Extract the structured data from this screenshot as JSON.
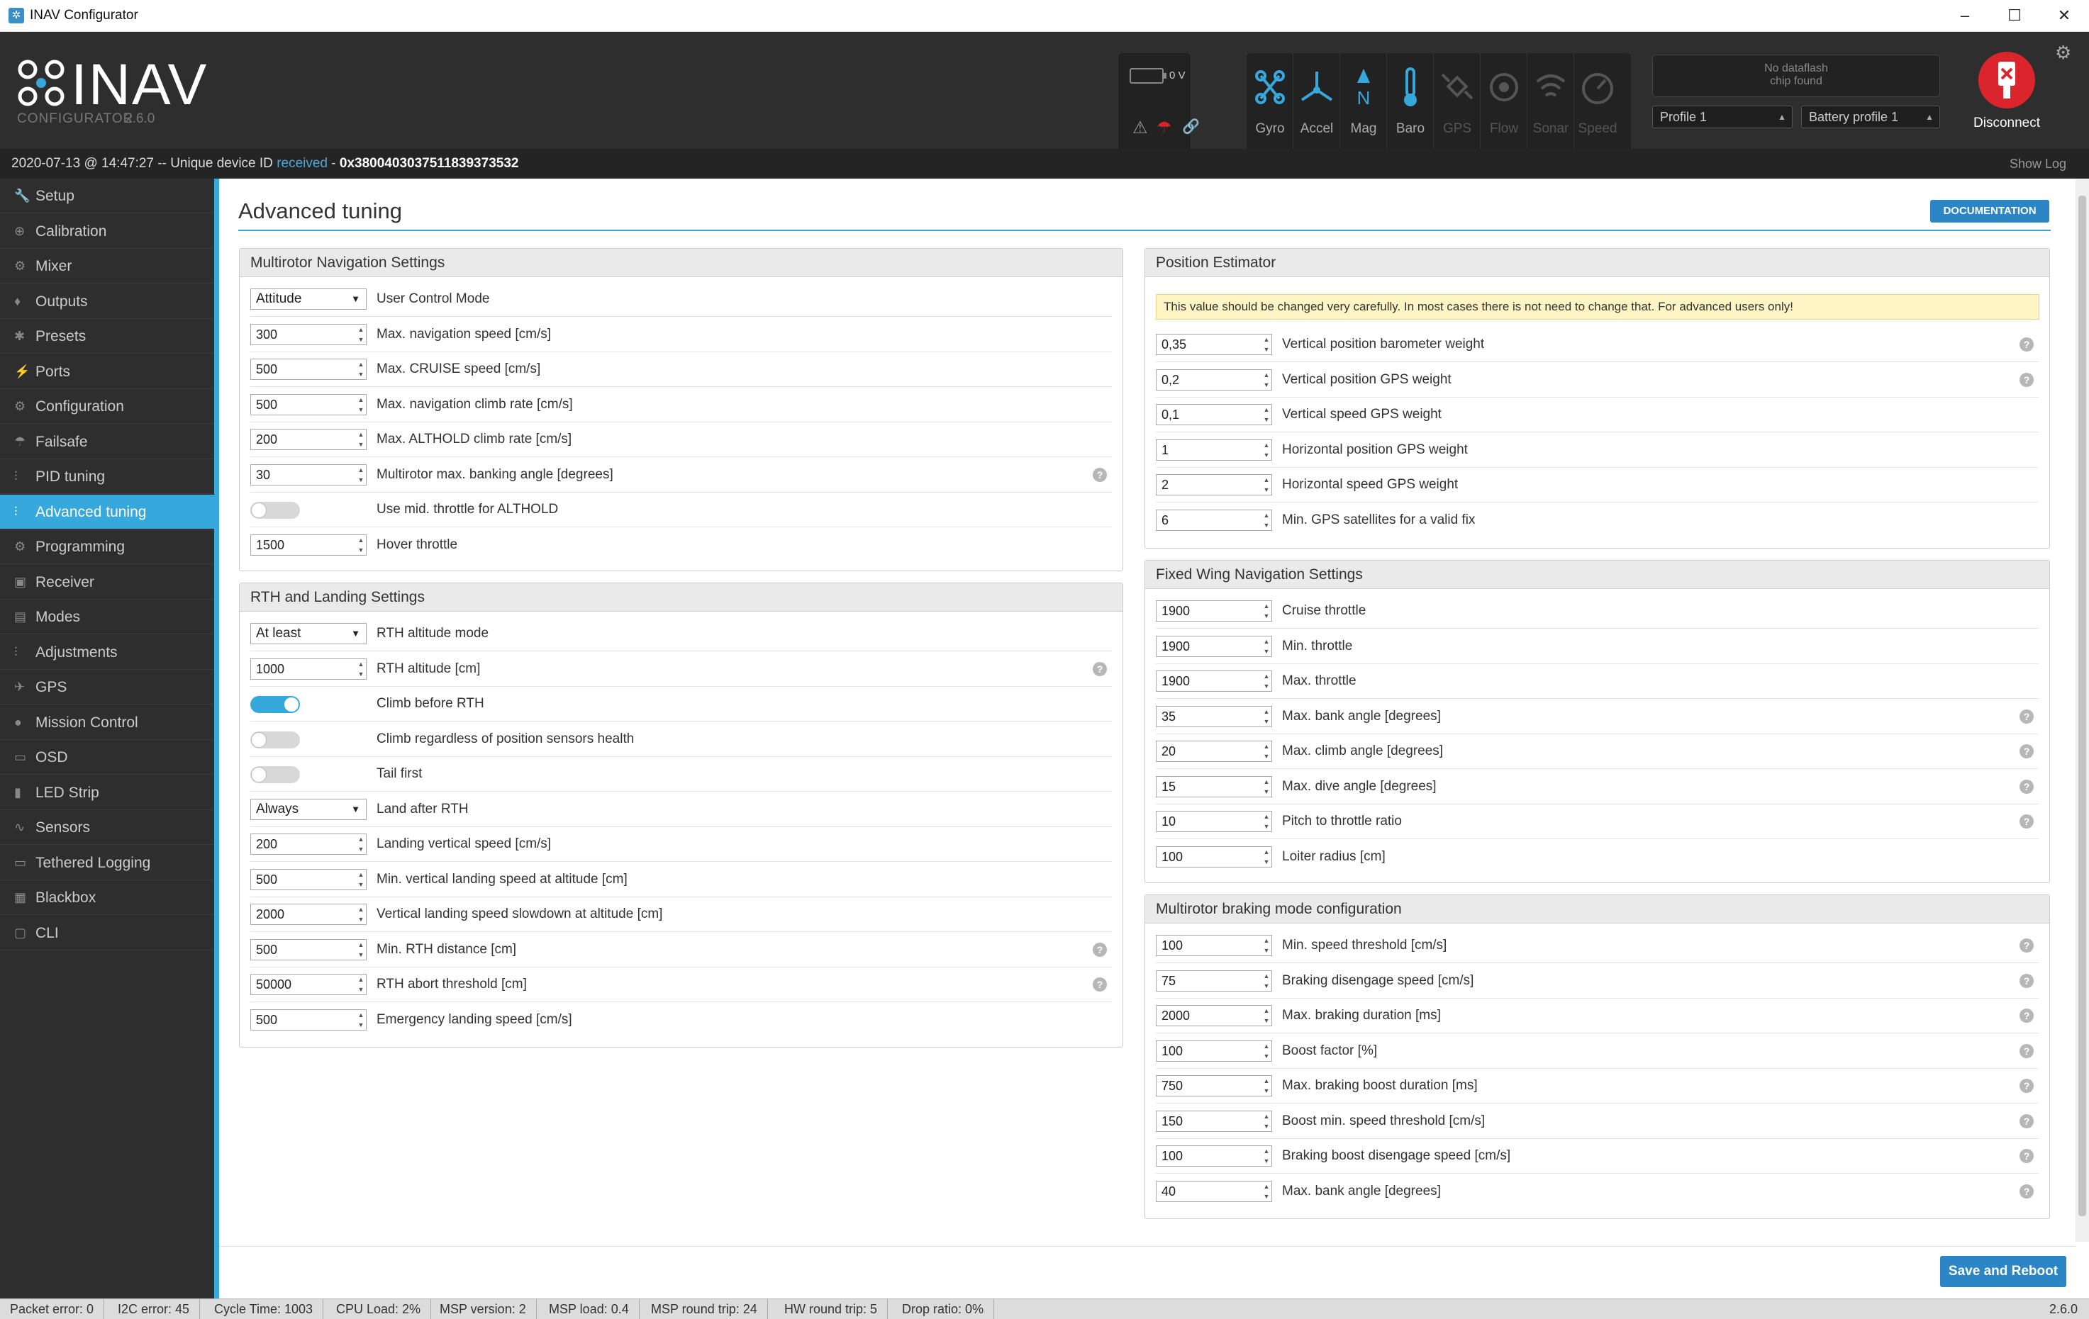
{
  "window": {
    "title": "INAV Configurator",
    "minimize": "–",
    "maximize": "☐",
    "close": "✕"
  },
  "header": {
    "logo_text": "INAV",
    "logo_sub": "CONFIGURATOR",
    "version": "2.6.0",
    "battery_voltage": "0 V",
    "sensors": [
      {
        "label": "Gyro",
        "active": true
      },
      {
        "label": "Accel",
        "active": true
      },
      {
        "label": "Mag",
        "active": true
      },
      {
        "label": "Baro",
        "active": true
      },
      {
        "label": "GPS",
        "active": false
      },
      {
        "label": "Flow",
        "active": false
      },
      {
        "label": "Sonar",
        "active": false
      },
      {
        "label": "Speed",
        "active": false
      }
    ],
    "dataflash_line1": "No dataflash",
    "dataflash_line2": "chip found",
    "profile": "Profile 1",
    "battery_profile": "Battery profile 1",
    "disconnect_label": "Disconnect"
  },
  "log": {
    "prefix": "2020-07-13 @ 14:47:27 -- Unique device ID ",
    "received": "received",
    "sep": " - ",
    "device_id": "0x380040303751183937353​2",
    "show_log": "Show Log"
  },
  "sidebar": {
    "items": [
      {
        "label": "Setup",
        "icon": "wrench-icon",
        "glyph": "🔧"
      },
      {
        "label": "Calibration",
        "icon": "crosshair-icon",
        "glyph": "⊕"
      },
      {
        "label": "Mixer",
        "icon": "mixer-icon",
        "glyph": "⚙"
      },
      {
        "label": "Outputs",
        "icon": "outputs-icon",
        "glyph": "♦"
      },
      {
        "label": "Presets",
        "icon": "presets-icon",
        "glyph": "✱"
      },
      {
        "label": "Ports",
        "icon": "plug-icon",
        "glyph": "⚡"
      },
      {
        "label": "Configuration",
        "icon": "gear-icon",
        "glyph": "⚙"
      },
      {
        "label": "Failsafe",
        "icon": "parachute-icon",
        "glyph": "☂"
      },
      {
        "label": "PID tuning",
        "icon": "sliders-icon",
        "glyph": "⫶"
      },
      {
        "label": "Advanced tuning",
        "icon": "tuning-icon",
        "glyph": "⫶"
      },
      {
        "label": "Programming",
        "icon": "cog-icon",
        "glyph": "⚙"
      },
      {
        "label": "Receiver",
        "icon": "receiver-icon",
        "glyph": "▣"
      },
      {
        "label": "Modes",
        "icon": "modes-icon",
        "glyph": "▤"
      },
      {
        "label": "Adjustments",
        "icon": "adjust-icon",
        "glyph": "⫶"
      },
      {
        "label": "GPS",
        "icon": "satellite-icon",
        "glyph": "✈"
      },
      {
        "label": "Mission Control",
        "icon": "map-pin-icon",
        "glyph": "●"
      },
      {
        "label": "OSD",
        "icon": "osd-icon",
        "glyph": "▭"
      },
      {
        "label": "LED Strip",
        "icon": "led-icon",
        "glyph": "▮"
      },
      {
        "label": "Sensors",
        "icon": "pulse-icon",
        "glyph": "∿"
      },
      {
        "label": "Tethered Logging",
        "icon": "tether-icon",
        "glyph": "▭"
      },
      {
        "label": "Blackbox",
        "icon": "blackbox-icon",
        "glyph": "▦"
      },
      {
        "label": "CLI",
        "icon": "terminal-icon",
        "glyph": "▢"
      }
    ],
    "active_index": 9
  },
  "page": {
    "title": "Advanced tuning",
    "documentation": "DOCUMENTATION",
    "save_reboot": "Save and Reboot"
  },
  "mc_nav": {
    "title": "Multirotor Navigation Settings",
    "rows": [
      {
        "type": "select",
        "value": "Attitude",
        "label": "User Control Mode"
      },
      {
        "type": "num",
        "value": "300",
        "label": "Max. navigation speed [cm/s]"
      },
      {
        "type": "num",
        "value": "500",
        "label": "Max. CRUISE speed [cm/s]"
      },
      {
        "type": "num",
        "value": "500",
        "label": "Max. navigation climb rate [cm/s]"
      },
      {
        "type": "num",
        "value": "200",
        "label": "Max. ALTHOLD climb rate [cm/s]"
      },
      {
        "type": "num",
        "value": "30",
        "label": "Multirotor max. banking angle [degrees]",
        "help": true
      },
      {
        "type": "toggle",
        "on": false,
        "label": "Use mid. throttle for ALTHOLD"
      },
      {
        "type": "num",
        "value": "1500",
        "label": "Hover throttle"
      }
    ]
  },
  "rth": {
    "title": "RTH and Landing Settings",
    "rows": [
      {
        "type": "select",
        "value": "At least",
        "label": "RTH altitude mode"
      },
      {
        "type": "num",
        "value": "1000",
        "label": "RTH altitude [cm]",
        "help": true
      },
      {
        "type": "toggle",
        "on": true,
        "label": "Climb before RTH"
      },
      {
        "type": "toggle",
        "on": false,
        "label": "Climb regardless of position sensors health"
      },
      {
        "type": "toggle",
        "on": false,
        "label": "Tail first"
      },
      {
        "type": "select",
        "value": "Always",
        "label": "Land after RTH"
      },
      {
        "type": "num",
        "value": "200",
        "label": "Landing vertical speed [cm/s]"
      },
      {
        "type": "num",
        "value": "500",
        "label": "Min. vertical landing speed at altitude [cm]"
      },
      {
        "type": "num",
        "value": "2000",
        "label": "Vertical landing speed slowdown at altitude [cm]"
      },
      {
        "type": "num",
        "value": "500",
        "label": "Min. RTH distance [cm]",
        "help": true
      },
      {
        "type": "num",
        "value": "50000",
        "label": "RTH abort threshold [cm]",
        "help": true
      },
      {
        "type": "num",
        "value": "500",
        "label": "Emergency landing speed [cm/s]"
      }
    ]
  },
  "pos_est": {
    "title": "Position Estimator",
    "warning": "This value should be changed very carefully. In most cases there is not need to change that. For advanced users only!",
    "rows": [
      {
        "type": "num",
        "value": "0,35",
        "label": "Vertical position barometer weight",
        "help": true
      },
      {
        "type": "num",
        "value": "0,2",
        "label": "Vertical position GPS weight",
        "help": true
      },
      {
        "type": "num",
        "value": "0,1",
        "label": "Vertical speed GPS weight"
      },
      {
        "type": "num",
        "value": "1",
        "label": "Horizontal position GPS weight"
      },
      {
        "type": "num",
        "value": "2",
        "label": "Horizontal speed GPS weight"
      },
      {
        "type": "num",
        "value": "6",
        "label": "Min. GPS satellites for a valid fix"
      }
    ]
  },
  "fw_nav": {
    "title": "Fixed Wing Navigation Settings",
    "rows": [
      {
        "type": "num",
        "value": "1900",
        "label": "Cruise throttle"
      },
      {
        "type": "num",
        "value": "1900",
        "label": "Min. throttle"
      },
      {
        "type": "num",
        "value": "1900",
        "label": "Max. throttle"
      },
      {
        "type": "num",
        "value": "35",
        "label": "Max. bank angle [degrees]",
        "help": true
      },
      {
        "type": "num",
        "value": "20",
        "label": "Max. climb angle [degrees]",
        "help": true
      },
      {
        "type": "num",
        "value": "15",
        "label": "Max. dive angle [degrees]",
        "help": true
      },
      {
        "type": "num",
        "value": "10",
        "label": "Pitch to throttle ratio",
        "help": true
      },
      {
        "type": "num",
        "value": "100",
        "label": "Loiter radius [cm]"
      }
    ]
  },
  "braking": {
    "title": "Multirotor braking mode configuration",
    "rows": [
      {
        "type": "num",
        "value": "100",
        "label": "Min. speed threshold [cm/s]",
        "help": true
      },
      {
        "type": "num",
        "value": "75",
        "label": "Braking disengage speed [cm/s]",
        "help": true
      },
      {
        "type": "num",
        "value": "2000",
        "label": "Max. braking duration [ms]",
        "help": true
      },
      {
        "type": "num",
        "value": "100",
        "label": "Boost factor [%]",
        "help": true
      },
      {
        "type": "num",
        "value": "750",
        "label": "Max. braking boost duration [ms]",
        "help": true
      },
      {
        "type": "num",
        "value": "150",
        "label": "Boost min. speed threshold [cm/s]",
        "help": true
      },
      {
        "type": "num",
        "value": "100",
        "label": "Braking boost disengage speed [cm/s]",
        "help": true
      },
      {
        "type": "num",
        "value": "40",
        "label": "Max. bank angle [degrees]",
        "help": true
      }
    ]
  },
  "status": {
    "items": [
      "Packet error: 0",
      "I2C error: 45",
      "Cycle Time: 1003",
      "CPU Load: 2%",
      "MSP version: 2",
      "MSP load: 0.4",
      "MSP round trip: 24",
      "HW round trip: 5",
      "Drop ratio: 0%"
    ],
    "version": "2.6.0"
  },
  "colors": {
    "accent": "#37a8db",
    "button": "#2c85c4",
    "disconnect": "#d9252b",
    "sensor_active": "#37a8db",
    "sensor_inactive": "#555555"
  }
}
